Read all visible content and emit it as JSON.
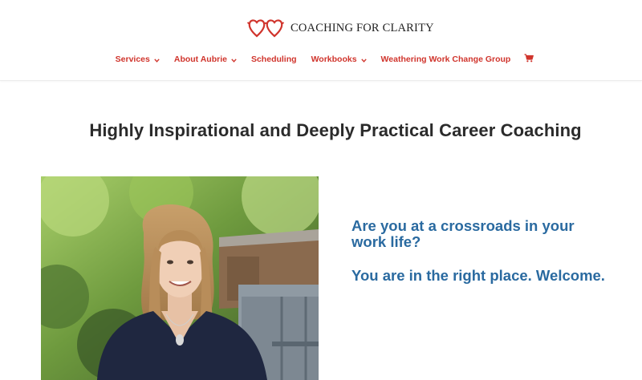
{
  "header": {
    "logo_text": "COACHING FOR CLARITY",
    "logo_icon": "heart-glasses-icon",
    "nav": [
      {
        "label": "Services",
        "has_dropdown": true
      },
      {
        "label": "About Aubrie",
        "has_dropdown": true
      },
      {
        "label": "Scheduling",
        "has_dropdown": false
      },
      {
        "label": "Workbooks",
        "has_dropdown": true
      },
      {
        "label": "Weathering Work Change Group",
        "has_dropdown": false
      }
    ],
    "cart_icon": "cart-icon"
  },
  "main": {
    "headline": "Highly Inspirational and Deeply Practical Career Coaching",
    "intro_question": "Are you at a crossroads in your work life?",
    "intro_welcome": "You are in the right place. Welcome."
  },
  "colors": {
    "accent_red": "#d0342c",
    "heading_blue": "#2a6aa0",
    "headline_text": "#2b2b2b"
  }
}
